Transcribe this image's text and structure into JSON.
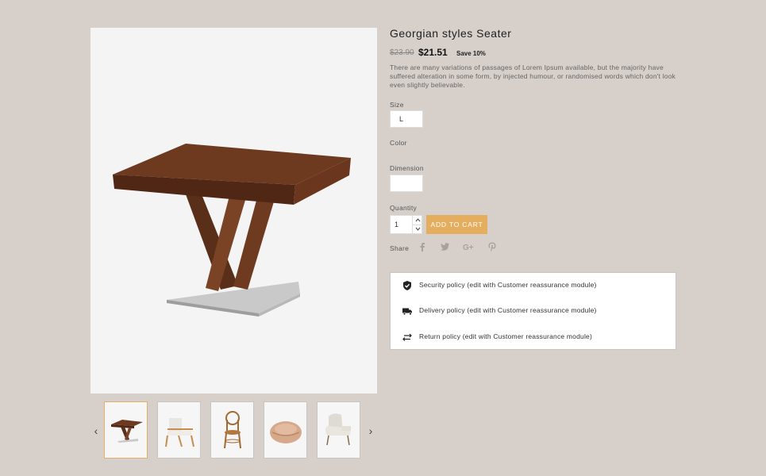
{
  "product": {
    "title": "Georgian styles Seater",
    "old_price": "$23.90",
    "price": "$21.51",
    "save": "Save 10%",
    "description": "There are many variations of passages of Lorem Ipsum available, but the majority have suffered alteration in some form, by injected humour, or randomised words which don't look even slightly believable."
  },
  "options": {
    "size_label": "Size",
    "size_value": "L",
    "color_label": "Color",
    "dimension_label": "Dimension",
    "dimension_value": "",
    "quantity_label": "Quantity",
    "quantity_value": "1",
    "qty_up": "^",
    "qty_down": "v"
  },
  "actions": {
    "add_to_cart": "ADD TO CART",
    "share_label": "Share",
    "share_icons": [
      "facebook-icon",
      "twitter-icon",
      "google-plus-icon",
      "pinterest-icon"
    ]
  },
  "thumbnails": {
    "prev": "‹",
    "next": "›",
    "items": [
      "table-thumbnail",
      "armchair-thumbnail",
      "bentwood-chair-thumbnail",
      "pouf-thumbnail",
      "wingback-chair-thumbnail"
    ]
  },
  "reassurance": [
    {
      "icon": "shield-check-icon",
      "text": "Security policy (edit with Customer reassurance module)"
    },
    {
      "icon": "truck-icon",
      "text": "Delivery policy (edit with Customer reassurance module)"
    },
    {
      "icon": "swap-arrows-icon",
      "text": "Return policy (edit with Customer reassurance module)"
    }
  ],
  "colors": {
    "background": "#d6cfca",
    "accent": "#e5ad5e",
    "wood": "#6b3a22"
  }
}
